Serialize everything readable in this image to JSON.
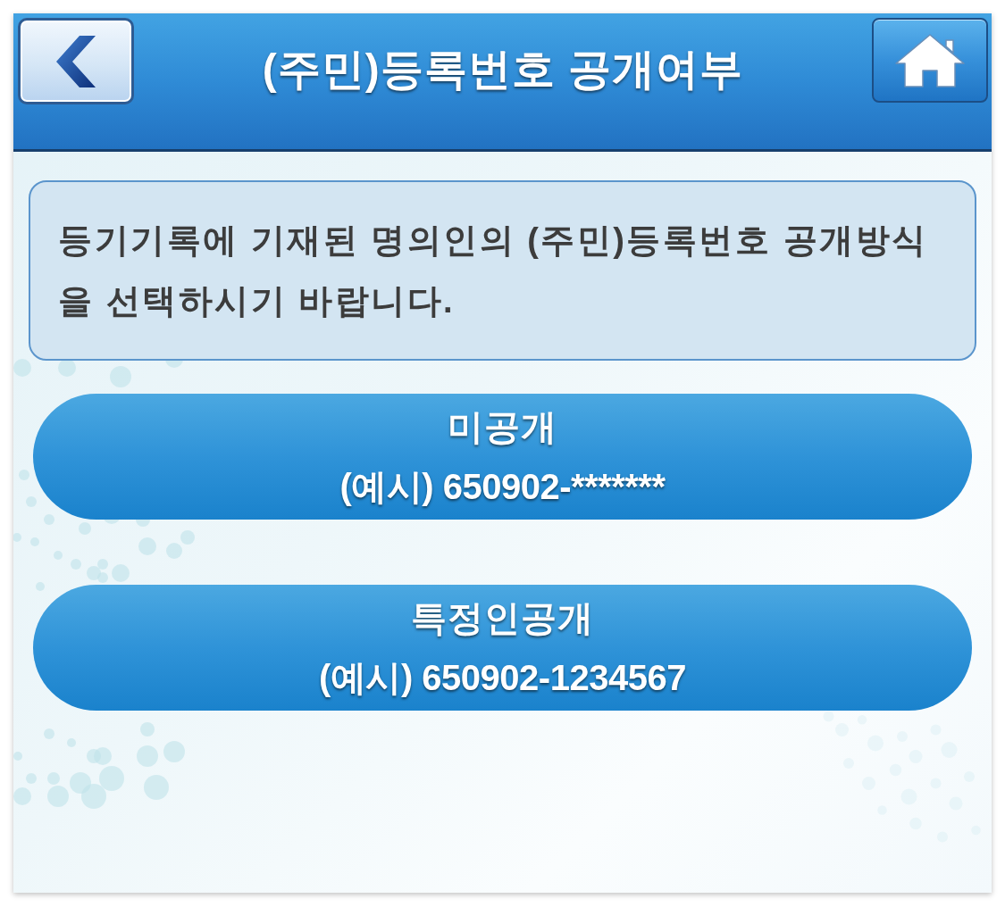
{
  "header": {
    "title": "(주민)등록번호 공개여부"
  },
  "notice": {
    "text": "등기기록에 기재된 명의인의 (주민)등록번호 공개방식을 선택하시기 바랍니다."
  },
  "options": [
    {
      "label": "미공개",
      "example": "(예시) 650902-*******"
    },
    {
      "label": "특정인공개",
      "example": "(예시) 650902-1234567"
    }
  ]
}
